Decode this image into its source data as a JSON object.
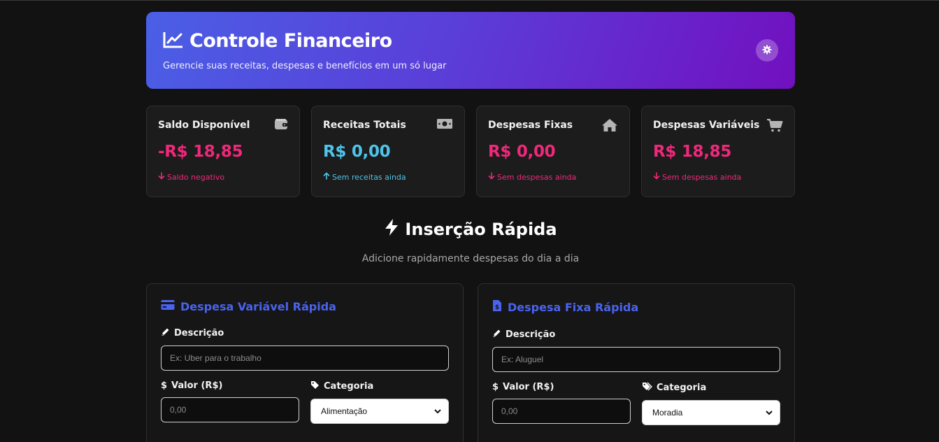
{
  "header": {
    "title": "Controle Financeiro",
    "subtitle": "Gerencie suas receitas, despesas e benefícios em um só lugar"
  },
  "cards": [
    {
      "title": "Saldo Disponível",
      "value": "-R$ 18,85",
      "note": "Saldo negativo",
      "icon": "wallet-icon"
    },
    {
      "title": "Receitas Totais",
      "value": "R$ 0,00",
      "note": "Sem receitas ainda",
      "icon": "money-bill-icon"
    },
    {
      "title": "Despesas Fixas",
      "value": "R$ 0,00",
      "note": "Sem despesas ainda",
      "icon": "home-icon"
    },
    {
      "title": "Despesas Variáveis",
      "value": "R$ 18,85",
      "note": "Sem despesas ainda",
      "icon": "cart-icon"
    }
  ],
  "quick": {
    "title": "Inserção Rápida",
    "subtitle": "Adicione rapidamente despesas do dia a dia"
  },
  "variable_form": {
    "title": "Despesa Variável Rápida",
    "description_label": "Descrição",
    "description_placeholder": "Ex: Uber para o trabalho",
    "value_label": "Valor (R$)",
    "value_placeholder": "0,00",
    "category_label": "Categoria",
    "category_selected": "Alimentação"
  },
  "fixed_form": {
    "title": "Despesa Fixa Rápida",
    "description_label": "Descrição",
    "description_placeholder": "Ex: Aluguel",
    "value_label": "Valor (R$)",
    "value_placeholder": "0,00",
    "category_label": "Categoria",
    "category_selected": "Moradia"
  },
  "colors": {
    "negative": "#f0287a",
    "positive": "#4ec4ea",
    "accent": "#4a63ee",
    "gradient_start": "#4a5fe6",
    "gradient_end": "#7210c0"
  }
}
